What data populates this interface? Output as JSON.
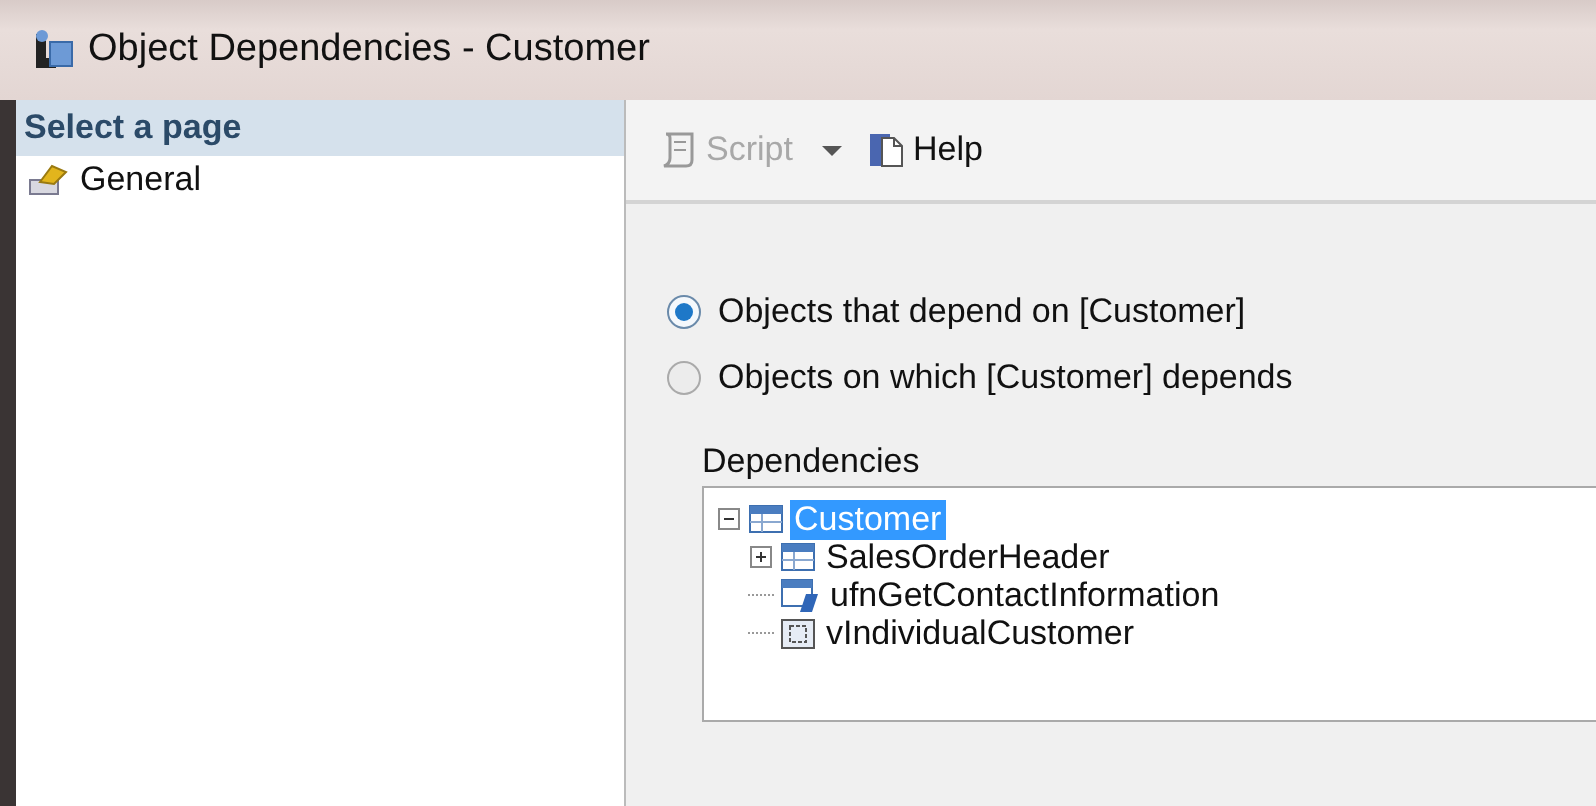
{
  "window": {
    "title": "Object Dependencies - Customer"
  },
  "sidebar": {
    "header": "Select a page",
    "items": [
      {
        "label": "General",
        "selected": false
      }
    ]
  },
  "toolbar": {
    "buttons": [
      {
        "label": "Script",
        "kind": "script",
        "disabled": true,
        "dropdown": true
      },
      {
        "label": "Help",
        "kind": "help",
        "disabled": false,
        "dropdown": false
      }
    ]
  },
  "direction": [
    {
      "label": "Objects that depend on [Customer]",
      "selected": true
    },
    {
      "label": "Objects on which [Customer] depends",
      "selected": false
    }
  ],
  "dependencies": {
    "label": "Dependencies",
    "tree": [
      {
        "label": "Customer",
        "kind": "table",
        "selected": true,
        "expanded": true,
        "children": [
          {
            "label": "SalesOrderHeader",
            "kind": "table",
            "selected": false,
            "expanded": false
          },
          {
            "label": "ufnGetContactInformation",
            "kind": "function",
            "selected": false
          },
          {
            "label": "vIndividualCustomer",
            "kind": "view",
            "selected": false
          }
        ]
      }
    ]
  }
}
